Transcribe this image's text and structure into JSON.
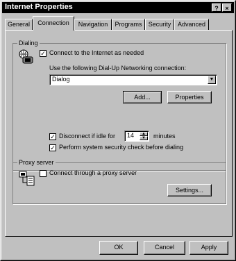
{
  "window": {
    "title": "Internet Properties",
    "help_glyph": "?",
    "close_glyph": "×"
  },
  "tabs": [
    {
      "label": "General"
    },
    {
      "label": "Connection"
    },
    {
      "label": "Navigation"
    },
    {
      "label": "Programs"
    },
    {
      "label": "Security"
    },
    {
      "label": "Advanced"
    }
  ],
  "dialing": {
    "legend": "Dialing",
    "connect_label": "Connect to the Internet as needed",
    "use_following_label": "Use the following Dial-Up Networking connection:",
    "connection_value": "Dialog",
    "add_label": "Add...",
    "properties_label": "Properties",
    "disconnect_label": "Disconnect if idle for",
    "idle_minutes": "14",
    "minutes_label": "minutes",
    "security_check_label": "Perform system security check before dialing"
  },
  "proxy": {
    "legend": "Proxy server",
    "connect_through_label": "Connect through a proxy server",
    "settings_label": "Settings..."
  },
  "footer": {
    "ok_label": "OK",
    "cancel_label": "Cancel",
    "apply_label": "Apply"
  },
  "check_glyph": "✓",
  "icons": {
    "dialing": "phone-globe-icon",
    "proxy": "network-computers-icon"
  }
}
